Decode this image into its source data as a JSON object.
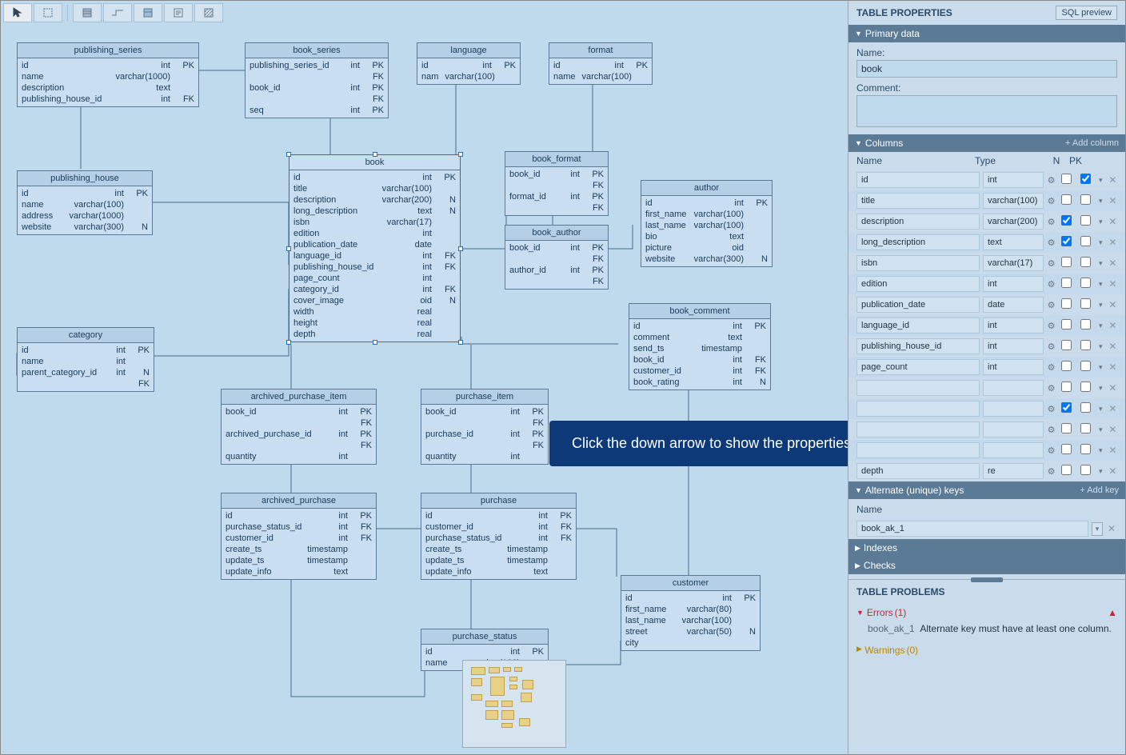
{
  "toolbar": {
    "tools": [
      "pointer",
      "marquee",
      "table",
      "relation",
      "view",
      "note",
      "region"
    ]
  },
  "callout": {
    "text": "Click the down arrow to show the properties"
  },
  "entities": {
    "publishing_series": {
      "title": "publishing_series",
      "cols": [
        {
          "name": "id",
          "type": "int",
          "flags": "PK"
        },
        {
          "name": "name",
          "type": "varchar(1000)",
          "flags": ""
        },
        {
          "name": "description",
          "type": "text",
          "flags": ""
        },
        {
          "name": "publishing_house_id",
          "type": "int",
          "flags": "FK"
        }
      ]
    },
    "publishing_house": {
      "title": "publishing_house",
      "cols": [
        {
          "name": "id",
          "type": "int",
          "flags": "PK"
        },
        {
          "name": "name",
          "type": "varchar(100)",
          "flags": ""
        },
        {
          "name": "address",
          "type": "varchar(1000)",
          "flags": ""
        },
        {
          "name": "website",
          "type": "varchar(300)",
          "flags": "N"
        }
      ]
    },
    "book_series": {
      "title": "book_series",
      "cols": [
        {
          "name": "publishing_series_id",
          "type": "int",
          "flags": "PK FK"
        },
        {
          "name": "book_id",
          "type": "int",
          "flags": "PK FK"
        },
        {
          "name": "seq",
          "type": "int",
          "flags": "PK"
        }
      ]
    },
    "language": {
      "title": "language",
      "cols": [
        {
          "name": "id",
          "type": "int",
          "flags": "PK"
        },
        {
          "name": "nam",
          "type": "varchar(100)",
          "flags": ""
        }
      ]
    },
    "format": {
      "title": "format",
      "cols": [
        {
          "name": "id",
          "type": "int",
          "flags": "PK"
        },
        {
          "name": "name",
          "type": "varchar(100)",
          "flags": ""
        }
      ]
    },
    "book": {
      "title": "book",
      "cols": [
        {
          "name": "id",
          "type": "int",
          "flags": "PK"
        },
        {
          "name": "title",
          "type": "varchar(100)",
          "flags": ""
        },
        {
          "name": "description",
          "type": "varchar(200)",
          "flags": "N"
        },
        {
          "name": "long_description",
          "type": "text",
          "flags": "N"
        },
        {
          "name": "isbn",
          "type": "varchar(17)",
          "flags": ""
        },
        {
          "name": "edition",
          "type": "int",
          "flags": ""
        },
        {
          "name": "publication_date",
          "type": "date",
          "flags": ""
        },
        {
          "name": "language_id",
          "type": "int",
          "flags": "FK"
        },
        {
          "name": "publishing_house_id",
          "type": "int",
          "flags": "FK"
        },
        {
          "name": "page_count",
          "type": "int",
          "flags": ""
        },
        {
          "name": "category_id",
          "type": "int",
          "flags": "FK"
        },
        {
          "name": "cover_image",
          "type": "oid",
          "flags": "N"
        },
        {
          "name": "width",
          "type": "real",
          "flags": ""
        },
        {
          "name": "height",
          "type": "real",
          "flags": ""
        },
        {
          "name": "depth",
          "type": "real",
          "flags": ""
        }
      ]
    },
    "book_format": {
      "title": "book_format",
      "cols": [
        {
          "name": "book_id",
          "type": "int",
          "flags": "PK FK"
        },
        {
          "name": "format_id",
          "type": "int",
          "flags": "PK FK"
        }
      ]
    },
    "book_author": {
      "title": "book_author",
      "cols": [
        {
          "name": "book_id",
          "type": "int",
          "flags": "PK FK"
        },
        {
          "name": "author_id",
          "type": "int",
          "flags": "PK FK"
        }
      ]
    },
    "author": {
      "title": "author",
      "cols": [
        {
          "name": "id",
          "type": "int",
          "flags": "PK"
        },
        {
          "name": "first_name",
          "type": "varchar(100)",
          "flags": ""
        },
        {
          "name": "last_name",
          "type": "varchar(100)",
          "flags": ""
        },
        {
          "name": "bio",
          "type": "text",
          "flags": ""
        },
        {
          "name": "picture",
          "type": "oid",
          "flags": ""
        },
        {
          "name": "website",
          "type": "varchar(300)",
          "flags": "N"
        }
      ]
    },
    "category": {
      "title": "category",
      "cols": [
        {
          "name": "id",
          "type": "int",
          "flags": "PK"
        },
        {
          "name": "name",
          "type": "int",
          "flags": ""
        },
        {
          "name": "parent_category_id",
          "type": "int",
          "flags": "N FK"
        }
      ]
    },
    "book_comment": {
      "title": "book_comment",
      "cols": [
        {
          "name": "id",
          "type": "int",
          "flags": "PK"
        },
        {
          "name": "comment",
          "type": "text",
          "flags": ""
        },
        {
          "name": "send_ts",
          "type": "timestamp",
          "flags": ""
        },
        {
          "name": "book_id",
          "type": "int",
          "flags": "FK"
        },
        {
          "name": "customer_id",
          "type": "int",
          "flags": "FK"
        },
        {
          "name": "book_rating",
          "type": "int",
          "flags": "N"
        }
      ]
    },
    "archived_purchase_item": {
      "title": "archived_purchase_item",
      "cols": [
        {
          "name": "book_id",
          "type": "int",
          "flags": "PK FK"
        },
        {
          "name": "archived_purchase_id",
          "type": "int",
          "flags": "PK FK"
        },
        {
          "name": "quantity",
          "type": "int",
          "flags": ""
        }
      ]
    },
    "purchase_item": {
      "title": "purchase_item",
      "cols": [
        {
          "name": "book_id",
          "type": "int",
          "flags": "PK FK"
        },
        {
          "name": "purchase_id",
          "type": "int",
          "flags": "PK FK"
        },
        {
          "name": "quantity",
          "type": "int",
          "flags": ""
        }
      ]
    },
    "archived_purchase": {
      "title": "archived_purchase",
      "cols": [
        {
          "name": "id",
          "type": "int",
          "flags": "PK"
        },
        {
          "name": "purchase_status_id",
          "type": "int",
          "flags": "FK"
        },
        {
          "name": "customer_id",
          "type": "int",
          "flags": "FK"
        },
        {
          "name": "create_ts",
          "type": "timestamp",
          "flags": ""
        },
        {
          "name": "update_ts",
          "type": "timestamp",
          "flags": ""
        },
        {
          "name": "update_info",
          "type": "text",
          "flags": ""
        }
      ]
    },
    "purchase": {
      "title": "purchase",
      "cols": [
        {
          "name": "id",
          "type": "int",
          "flags": "PK"
        },
        {
          "name": "customer_id",
          "type": "int",
          "flags": "FK"
        },
        {
          "name": "purchase_status_id",
          "type": "int",
          "flags": "FK"
        },
        {
          "name": "create_ts",
          "type": "timestamp",
          "flags": ""
        },
        {
          "name": "update_ts",
          "type": "timestamp",
          "flags": ""
        },
        {
          "name": "update_info",
          "type": "text",
          "flags": ""
        }
      ]
    },
    "customer": {
      "title": "customer",
      "cols": [
        {
          "name": "id",
          "type": "int",
          "flags": "PK"
        },
        {
          "name": "first_name",
          "type": "varchar(80)",
          "flags": ""
        },
        {
          "name": "last_name",
          "type": "varchar(100)",
          "flags": ""
        },
        {
          "name": "street",
          "type": "varchar(50)",
          "flags": "N"
        },
        {
          "name": "city",
          "type": "",
          "flags": ""
        }
      ]
    },
    "purchase_status": {
      "title": "purchase_status",
      "cols": [
        {
          "name": "id",
          "type": "int",
          "flags": "PK"
        },
        {
          "name": "name",
          "type": "varchar(100)",
          "flags": ""
        }
      ]
    }
  },
  "panel": {
    "title": "TABLE PROPERTIES",
    "sql_preview": "SQL preview",
    "primary": {
      "header": "Primary data",
      "name_label": "Name:",
      "name_value": "book",
      "comment_label": "Comment:",
      "comment_value": ""
    },
    "columns_header": "Columns",
    "add_column": "+ Add column",
    "column_labels": {
      "name": "Name",
      "type": "Type",
      "n": "N",
      "pk": "PK"
    },
    "columns": [
      {
        "name": "id",
        "type": "int",
        "n": false,
        "pk": true
      },
      {
        "name": "title",
        "type": "varchar(100)",
        "n": false,
        "pk": false
      },
      {
        "name": "description",
        "type": "varchar(200)",
        "n": true,
        "pk": false
      },
      {
        "name": "long_description",
        "type": "text",
        "n": true,
        "pk": false
      },
      {
        "name": "isbn",
        "type": "varchar(17)",
        "n": false,
        "pk": false
      },
      {
        "name": "edition",
        "type": "int",
        "n": false,
        "pk": false
      },
      {
        "name": "publication_date",
        "type": "date",
        "n": false,
        "pk": false
      },
      {
        "name": "language_id",
        "type": "int",
        "n": false,
        "pk": false
      },
      {
        "name": "publishing_house_id",
        "type": "int",
        "n": false,
        "pk": false
      },
      {
        "name": "page_count",
        "type": "int",
        "n": false,
        "pk": false
      },
      {
        "name": "",
        "type": "",
        "n": false,
        "pk": false
      },
      {
        "name": "",
        "type": "",
        "n": true,
        "pk": false
      },
      {
        "name": "",
        "type": "",
        "n": false,
        "pk": false
      },
      {
        "name": "",
        "type": "",
        "n": false,
        "pk": false
      },
      {
        "name": "depth",
        "type": "re",
        "n": false,
        "pk": false
      }
    ],
    "alt_keys": {
      "header": "Alternate (unique) keys",
      "add": "+ Add key",
      "name_label": "Name",
      "key_name": "book_ak_1"
    },
    "indexes": "Indexes",
    "checks": "Checks",
    "problems": {
      "header": "TABLE PROBLEMS",
      "errors_label": "Errors",
      "errors_count": "(1)",
      "error_key": "book_ak_1",
      "error_text": "Alternate key must have at least one column.",
      "warnings_label": "Warnings",
      "warnings_count": "(0)"
    }
  }
}
